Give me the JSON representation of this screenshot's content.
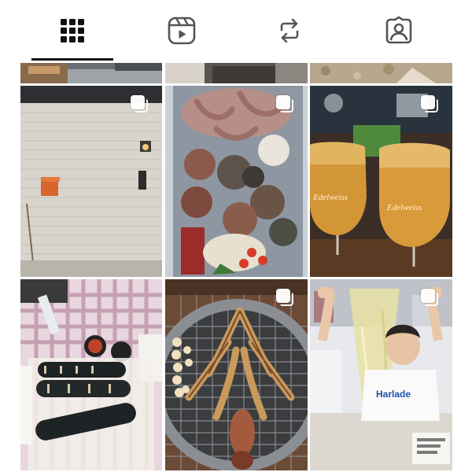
{
  "profile_tabs": [
    {
      "name": "posts-grid",
      "icon": "grid-icon",
      "active": true
    },
    {
      "name": "reels",
      "icon": "reels-icon",
      "active": false
    },
    {
      "name": "reposts",
      "icon": "repost-icon",
      "active": false
    },
    {
      "name": "tagged",
      "icon": "tagged-person-icon",
      "active": false
    }
  ],
  "colors": {
    "icon_active": "#111111",
    "icon_inactive": "#555555",
    "indicator": "#111111",
    "background": "#ffffff"
  },
  "posts": [
    {
      "subject": "partial-top-1",
      "multi_photo": false
    },
    {
      "subject": "partial-top-2",
      "multi_photo": false
    },
    {
      "subject": "partial-top-3",
      "multi_photo": false
    },
    {
      "subject": "brick-wall-with-lamp-and-mailbox",
      "multi_photo": true
    },
    {
      "subject": "seafood-platter-with-octopus",
      "multi_photo": true
    },
    {
      "subject": "glasses-of-edelweiss-beer",
      "multi_photo": true
    },
    {
      "subject": "kimbap-rolls-on-picnic-table",
      "multi_photo": false
    },
    {
      "subject": "squid-on-charcoal-grill",
      "multi_photo": true
    },
    {
      "subject": "child-holding-slime-sheet",
      "multi_photo": true
    }
  ],
  "photo_text": {
    "beer_glass_brand": "Edelweiss",
    "shirt_print": "Harlade"
  }
}
